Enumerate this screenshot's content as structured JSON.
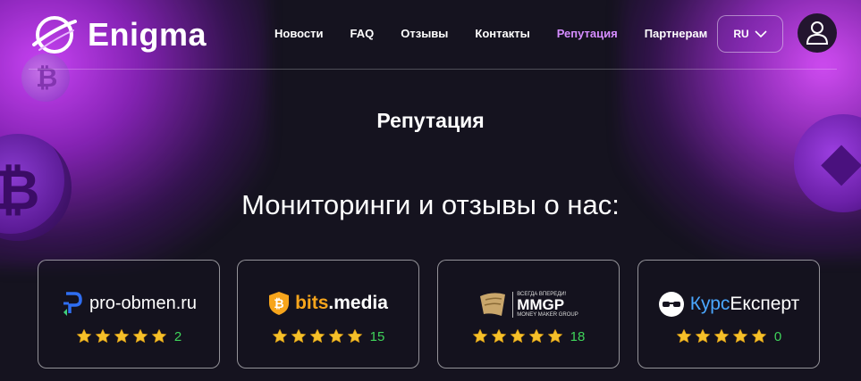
{
  "header": {
    "brand": "Enigma",
    "nav": [
      {
        "label": "Новости",
        "active": false
      },
      {
        "label": "FAQ",
        "active": false
      },
      {
        "label": "Отзывы",
        "active": false
      },
      {
        "label": "Контакты",
        "active": false
      },
      {
        "label": "Репутация",
        "active": true
      },
      {
        "label": "Партнерам",
        "active": false
      }
    ],
    "language": "RU"
  },
  "main": {
    "page_title": "Репутация",
    "section_title": "Мониторинги и отзывы о нас:",
    "monitorings": [
      {
        "name_part1": "pro-obmen.ru",
        "name_part2": "",
        "rating_stars": 5,
        "count": "2"
      },
      {
        "name_part1": "bits",
        "name_part2": ".media",
        "rating_stars": 5,
        "count": "15"
      },
      {
        "name_part1": "MMGP",
        "tagline": "ВСЕГДА ВПЕРЕДИ!",
        "subline": "MONEY MAKER GROUP",
        "rating_stars": 5,
        "count": "18"
      },
      {
        "name_part1": "Курс",
        "name_part2": "Експерт",
        "rating_stars": 5,
        "count": "0"
      }
    ]
  },
  "colors": {
    "accent": "#d58cff",
    "star": "#f5c02a",
    "count": "#3fd45a",
    "background": "#15131f"
  }
}
